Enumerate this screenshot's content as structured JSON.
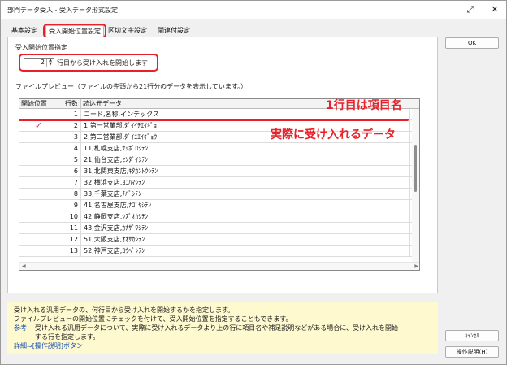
{
  "window": {
    "title": "部門データ受入 - 受入データ形式設定",
    "expand_glyph": "⤢",
    "close_glyph": "✕"
  },
  "tabs": [
    {
      "label": "基本設定",
      "active": false
    },
    {
      "label": "受入開始位置設定",
      "active": true
    },
    {
      "label": "区切文字設定",
      "active": false
    },
    {
      "label": "関連付設定",
      "active": false
    }
  ],
  "start_position": {
    "group_title": "受入開始位置指定",
    "value": "2",
    "suffix": "行目から受け入れを開始します"
  },
  "preview": {
    "group_title": "ファイルプレビュー（ファイルの先頭から21行分のデータを表示しています。）",
    "columns": [
      "開始位置",
      "行数",
      "読込元データ"
    ],
    "rows": [
      {
        "checked": false,
        "line": "1",
        "data": "コード,名称,インデックス"
      },
      {
        "checked": true,
        "line": "2",
        "data": "1,第一営業部,ﾀﾞｲｲﾁｴｲｷﾞｮ"
      },
      {
        "checked": false,
        "line": "3",
        "data": "2,第二営業部,ﾀﾞｲﾆｴｲｷﾞｮｳ"
      },
      {
        "checked": false,
        "line": "4",
        "data": "11,札幌支店,ｻｯﾎﾟﾛｼﾃﾝ"
      },
      {
        "checked": false,
        "line": "5",
        "data": "21,仙台支店,ｾﾝﾀﾞｲｼﾃﾝ"
      },
      {
        "checked": false,
        "line": "6",
        "data": "31,北関東支店,ｷﾀｶﾝﾄｳｼﾃﾝ"
      },
      {
        "checked": false,
        "line": "7",
        "data": "32,横浜支店,ﾖｺﾊﾏｼﾃﾝ"
      },
      {
        "checked": false,
        "line": "8",
        "data": "33,千葉支店,ﾁﾊﾞｼﾃﾝ"
      },
      {
        "checked": false,
        "line": "9",
        "data": "41,名古屋支店,ﾅｺﾞﾔｼﾃﾝ"
      },
      {
        "checked": false,
        "line": "10",
        "data": "42,静岡支店,ｼｽﾞｵｶｼﾃﾝ"
      },
      {
        "checked": false,
        "line": "11",
        "data": "43,金沢支店,ｶﾅｻﾞﾜｼﾃﾝ"
      },
      {
        "checked": false,
        "line": "12",
        "data": "51,大阪支店,ｵｵｻｶｼﾃﾝ"
      },
      {
        "checked": false,
        "line": "13",
        "data": "52,神戸支店,ｺｳﾍﾞｼﾃﾝ"
      }
    ],
    "check_glyph": "✓"
  },
  "annotations": {
    "header_callout": "1行目は項目名",
    "data_callout": "実際に受け入れるデータ"
  },
  "buttons": {
    "ok": "OK",
    "cancel": "ｷｬﾝｾﾙ",
    "help": "操作説明(H)"
  },
  "help_text": {
    "line1": "受け入れる汎用データの、何行目から受け入れを開始するかを指定します。",
    "line2": "ファイルプレビューの開始位置にチェックを付けて、受入開始位置を指定することもできます。",
    "note_label": "参考",
    "note_line1": "受け入れる汎用データについて、実際に受け入れるデータより上の行に項目名や補足説明などがある場合に、受け入れを開始",
    "note_line2": "する行を指定します。",
    "detail_label": "詳細⇒[操作説明]ボタン"
  },
  "colors": {
    "accent_red": "#e8202a",
    "check_pink": "#d4226a",
    "help_bg": "#fff9cf",
    "link_blue": "#1b4fb0"
  }
}
